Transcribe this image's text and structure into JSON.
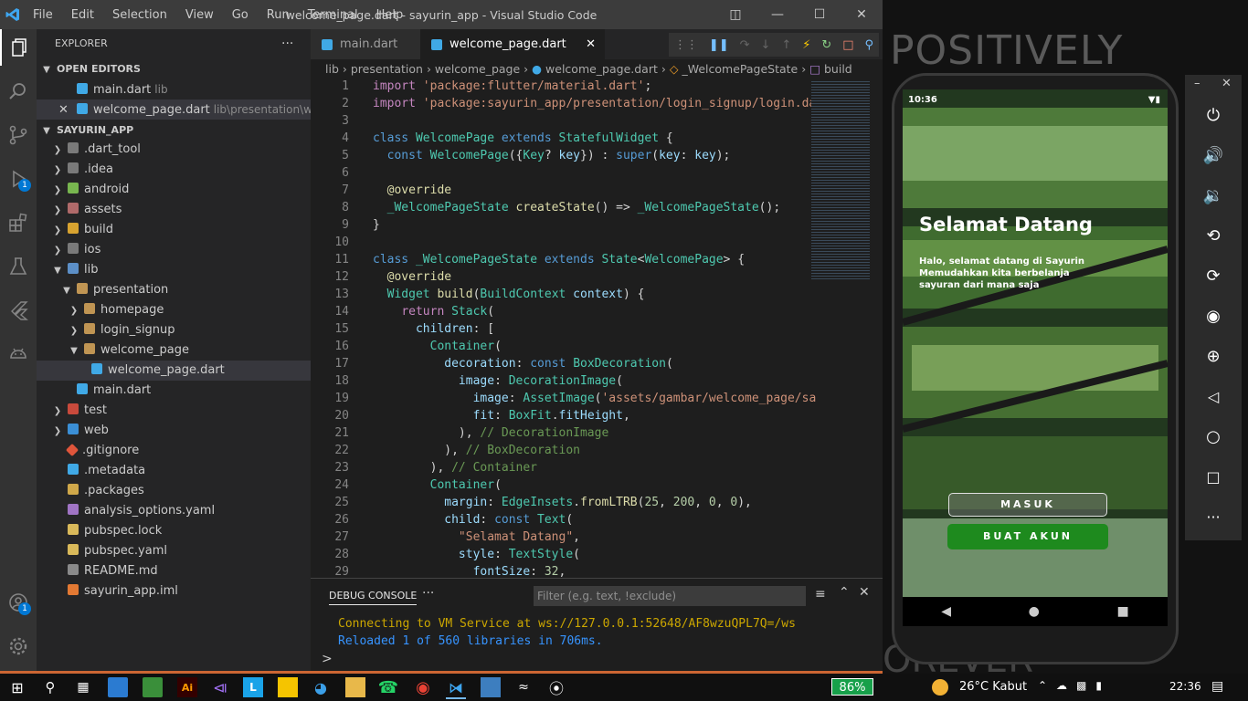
{
  "window": {
    "title": "welcome_page.dart - sayurin_app - Visual Studio Code",
    "menu": [
      "File",
      "Edit",
      "Selection",
      "View",
      "Go",
      "Run",
      "Terminal",
      "Help"
    ]
  },
  "activity_bar": {
    "badges": {
      "run_debug": "1",
      "accounts": "1"
    }
  },
  "sidebar": {
    "title": "EXPLORER",
    "open_editors_label": "OPEN EDITORS",
    "open_editors": [
      {
        "name": "main.dart",
        "path": "lib"
      },
      {
        "name": "welcome_page.dart",
        "path": "lib\\presentation\\welc..."
      }
    ],
    "project_label": "SAYURIN_APP",
    "tree": [
      {
        "name": ".dart_tool",
        "type": "folder"
      },
      {
        "name": ".idea",
        "type": "folder"
      },
      {
        "name": "android",
        "type": "folder"
      },
      {
        "name": "assets",
        "type": "folder"
      },
      {
        "name": "build",
        "type": "folder"
      },
      {
        "name": "ios",
        "type": "folder"
      },
      {
        "name": "lib",
        "type": "folder-open"
      },
      {
        "name": "presentation",
        "type": "folder-open"
      },
      {
        "name": "homepage",
        "type": "folder"
      },
      {
        "name": "login_signup",
        "type": "folder"
      },
      {
        "name": "welcome_page",
        "type": "folder-open"
      },
      {
        "name": "welcome_page.dart",
        "type": "dart"
      },
      {
        "name": "main.dart",
        "type": "dart"
      },
      {
        "name": "test",
        "type": "folder"
      },
      {
        "name": "web",
        "type": "folder"
      },
      {
        "name": ".gitignore",
        "type": "git"
      },
      {
        "name": ".metadata",
        "type": "flutter"
      },
      {
        "name": ".packages",
        "type": "file"
      },
      {
        "name": "analysis_options.yaml",
        "type": "yaml"
      },
      {
        "name": "pubspec.lock",
        "type": "lock"
      },
      {
        "name": "pubspec.yaml",
        "type": "yaml"
      },
      {
        "name": "README.md",
        "type": "md"
      },
      {
        "name": "sayurin_app.iml",
        "type": "iml"
      }
    ]
  },
  "tabs": [
    {
      "label": "main.dart"
    },
    {
      "label": "welcome_page.dart"
    }
  ],
  "breadcrumb": [
    "lib",
    "presentation",
    "welcome_page",
    "welcome_page.dart",
    "_WelcomePageState",
    "build"
  ],
  "code_lines": [
    "1",
    "2",
    "3",
    "4",
    "5",
    "6",
    "7",
    "8",
    "9",
    "10",
    "11",
    "12",
    "13",
    "14",
    "15",
    "16",
    "17",
    "18",
    "19",
    "20",
    "21",
    "22",
    "23",
    "24",
    "25",
    "26",
    "27",
    "28",
    "29"
  ],
  "panel": {
    "tab_label": "DEBUG CONSOLE",
    "filter_placeholder": "Filter (e.g. text, !exclude)",
    "lines": [
      "Connecting to VM Service at ws://127.0.0.1:52648/AF8wzuQPL7Q=/ws",
      "Reloaded 1 of 560 libraries in 706ms."
    ],
    "prompt": ">"
  },
  "phone": {
    "status_time": "10:36",
    "title": "Selamat Datang",
    "subtitle": "Halo, selamat datang di Sayurin Memudahkan kita berbelanja sayuran dari mana saja",
    "login_button": "MASUK",
    "signup_button": "BUAT AKUN",
    "colors": {
      "signup": "#1e8a1e",
      "background": "#2e4b2a"
    }
  },
  "desktop_text": {
    "top": "POSITIVELY",
    "bottom": "OREVER"
  },
  "taskbar": {
    "battery": "86%",
    "weather": "26°C  Kabut",
    "clock": "22:36"
  }
}
